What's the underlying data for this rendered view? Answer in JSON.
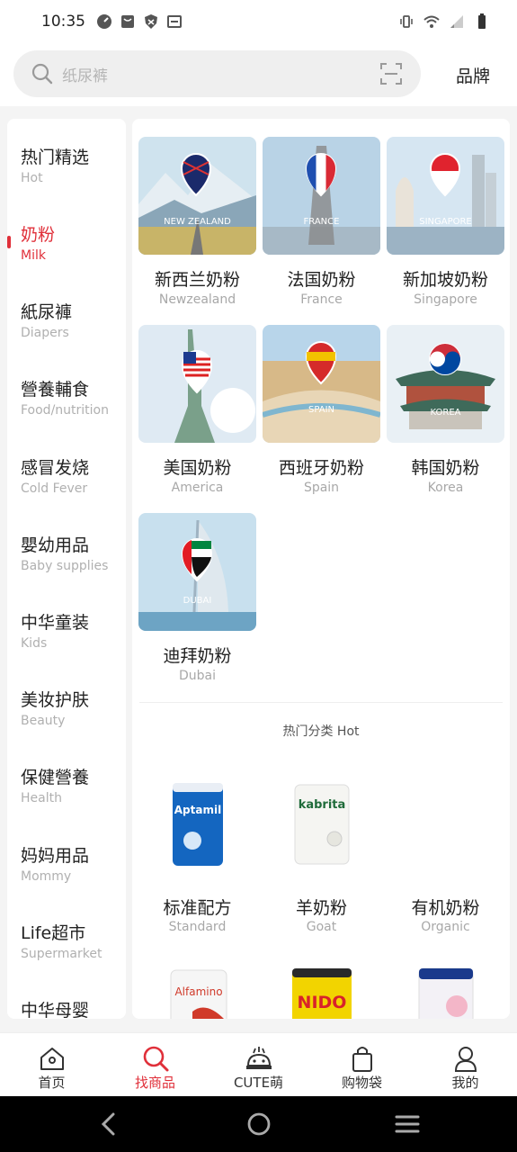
{
  "status_bar": {
    "time": "10:35"
  },
  "search": {
    "placeholder": "纸尿裤",
    "brand_label": "品牌"
  },
  "sidebar": {
    "items": [
      {
        "cn": "热门精选",
        "en": "Hot",
        "active": false
      },
      {
        "cn": "奶粉",
        "en": "Milk",
        "active": true
      },
      {
        "cn": "紙尿褲",
        "en": "Diapers",
        "active": false
      },
      {
        "cn": "營養輔食",
        "en": "Food/nutrition",
        "active": false
      },
      {
        "cn": "感冒发烧",
        "en": "Cold Fever",
        "active": false
      },
      {
        "cn": "嬰幼用品",
        "en": "Baby supplies",
        "active": false
      },
      {
        "cn": "中华童装",
        "en": "Kids",
        "active": false
      },
      {
        "cn": "美妆护肤",
        "en": "Beauty",
        "active": false
      },
      {
        "cn": "保健營養",
        "en": "Health",
        "active": false
      },
      {
        "cn": "妈妈用品",
        "en": "Mommy",
        "active": false
      },
      {
        "cn": "Life超市",
        "en": "Supermarket",
        "active": false
      },
      {
        "cn": "中华母婴",
        "en": "",
        "active": false
      }
    ]
  },
  "countries": [
    {
      "cn": "新西兰奶粉",
      "en": "Newzealand",
      "overlay": "NEW ZEALAND"
    },
    {
      "cn": "法国奶粉",
      "en": "France",
      "overlay": "FRANCE"
    },
    {
      "cn": "新加坡奶粉",
      "en": "Singapore",
      "overlay": "SINGAPORE"
    },
    {
      "cn": "美国奶粉",
      "en": "America",
      "overlay": ""
    },
    {
      "cn": "西班牙奶粉",
      "en": "Spain",
      "overlay": "SPAIN"
    },
    {
      "cn": "韩国奶粉",
      "en": "Korea",
      "overlay": "KOREA"
    },
    {
      "cn": "迪拜奶粉",
      "en": "Dubai",
      "overlay": "DUBAI"
    }
  ],
  "hot_section": {
    "title": "热门分类 Hot"
  },
  "products": [
    {
      "cn": "标准配方",
      "en": "Standard",
      "brand": "Aptamil",
      "brand_color": "#1466c0"
    },
    {
      "cn": "羊奶粉",
      "en": "Goat",
      "brand": "kabrita",
      "brand_color": "#1f6b3a"
    },
    {
      "cn": "有机奶粉",
      "en": "Organic",
      "brand": "",
      "brand_color": "#ffffff"
    },
    {
      "cn": "",
      "en": "",
      "brand": "Alfamino",
      "brand_color": "#d03a2a"
    },
    {
      "cn": "",
      "en": "",
      "brand": "NIDO",
      "brand_color": "#d8222a"
    },
    {
      "cn": "",
      "en": "",
      "brand": "",
      "brand_color": "#1a3a8c"
    }
  ],
  "bottom_nav": [
    {
      "label": "首页",
      "icon": "home-icon",
      "active": false
    },
    {
      "label": "找商品",
      "icon": "search-icon",
      "active": true
    },
    {
      "label": "CUTE萌",
      "icon": "mascot-icon",
      "active": false
    },
    {
      "label": "购物袋",
      "icon": "shopping-bag-icon",
      "active": false
    },
    {
      "label": "我的",
      "icon": "profile-icon",
      "active": false
    }
  ],
  "colors": {
    "accent": "#e0303a",
    "background": "#f4f4f4"
  }
}
